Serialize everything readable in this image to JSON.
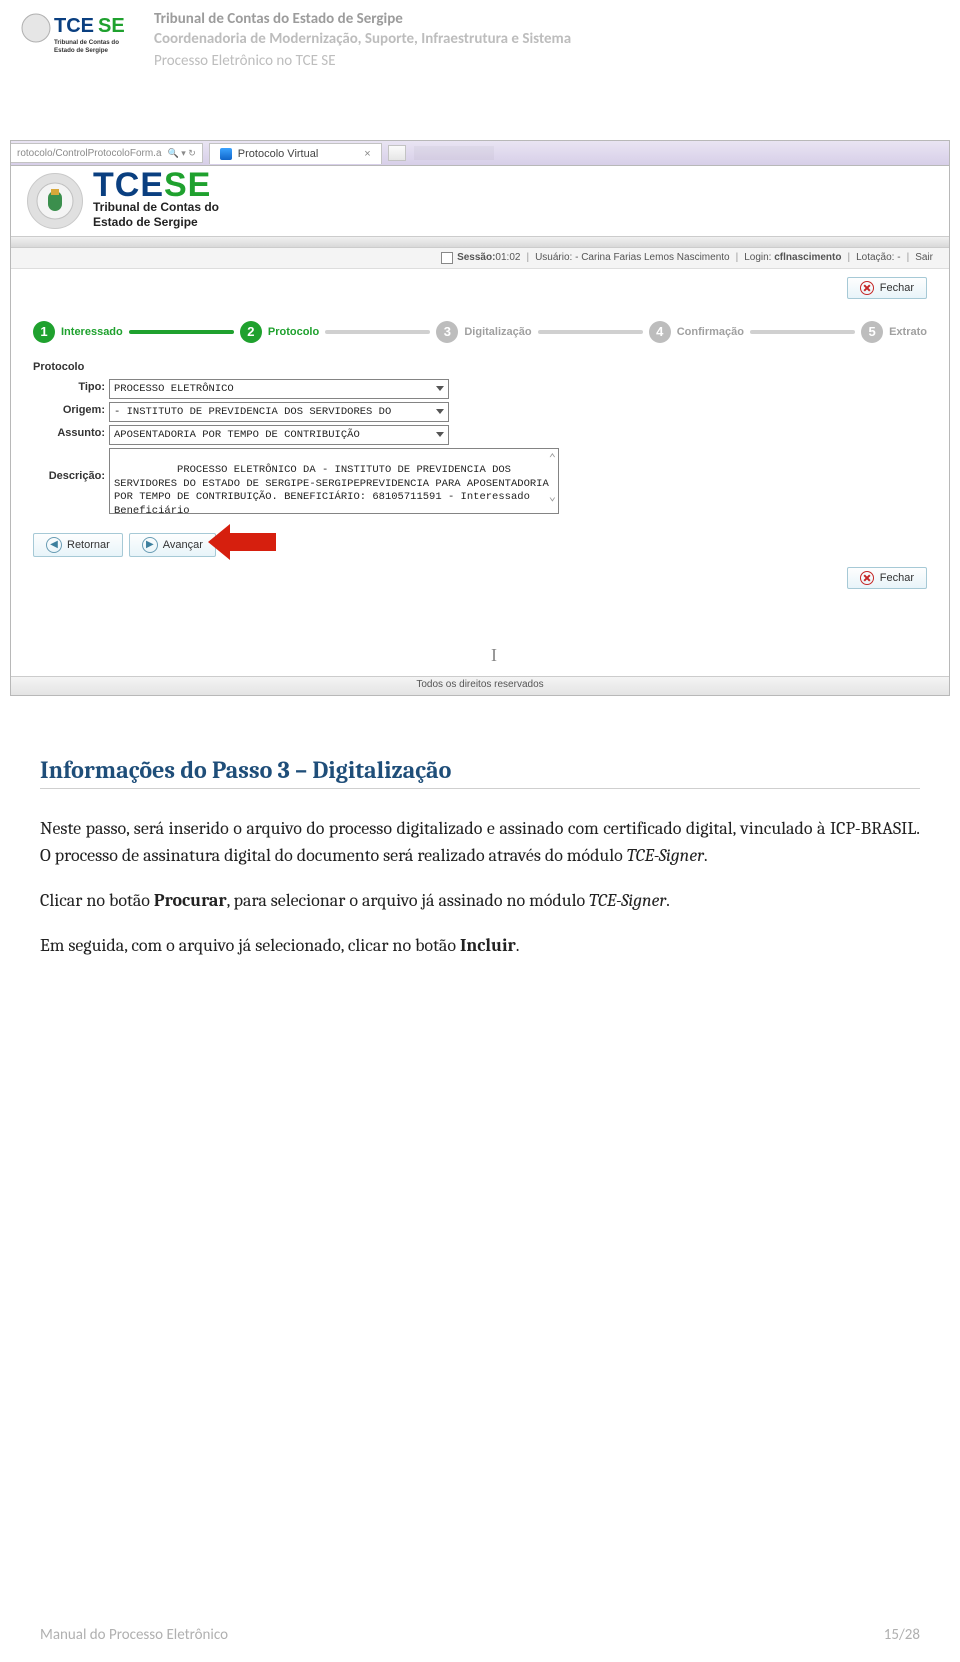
{
  "doc_header": {
    "org": "Tribunal de Contas do Estado de Sergipe",
    "dept": "Coordenadoria de Modernização, Suporte, Infraestrutura e Sistema",
    "doc": "Processo Eletrônico no TCE SE"
  },
  "ie": {
    "url_fragment": "rotocolo/ControlProtocoloForm.a",
    "search_refresh": "🔍 ▾ 🔄",
    "tab_title": "Protocolo Virtual",
    "tab_close": "×"
  },
  "site": {
    "tc": "TCE",
    "se": "SE",
    "sub1": "Tribunal de Contas do",
    "sub2": "Estado de Sergipe"
  },
  "session": {
    "sess_label": "Sessão:",
    "sess_val": "01:02",
    "user_label": "Usuário:",
    "user_val": "- Carina Farias Lemos Nascimento",
    "login_label": "Login:",
    "login_val": "cflnascimento",
    "lot_label": "Lotação:",
    "lot_val": "-",
    "exit": "Sair"
  },
  "buttons": {
    "fechar": "Fechar",
    "retornar": "Retornar",
    "avancar": "Avançar"
  },
  "stepper": [
    {
      "num": "1",
      "label": "Interessado",
      "on": true
    },
    {
      "num": "2",
      "label": "Protocolo",
      "on": true
    },
    {
      "num": "3",
      "label": "Digitalização",
      "on": false
    },
    {
      "num": "4",
      "label": "Confirmação",
      "on": false
    },
    {
      "num": "5",
      "label": "Extrato",
      "on": false
    }
  ],
  "form": {
    "section": "Protocolo",
    "tipo_label": "Tipo:",
    "tipo_val": "PROCESSO ELETRÔNICO",
    "origem_label": "Origem:",
    "origem_val": "- INSTITUTO DE PREVIDENCIA DOS SERVIDORES DO",
    "assunto_label": "Assunto:",
    "assunto_val": "APOSENTADORIA POR TEMPO DE CONTRIBUIÇÃO",
    "desc_label": "Descrição:",
    "desc_val": "PROCESSO ELETRÔNICO DA - INSTITUTO DE PREVIDENCIA DOS SERVIDORES DO ESTADO DE SERGIPE-SERGIPEPREVIDENCIA PARA APOSENTADORIA POR TEMPO DE CONTRIBUIÇÃO. BENEFICIÁRIO: 68105711591 - Interessado Beneficiário"
  },
  "site_footer": "Todos os direitos reservados",
  "article": {
    "heading": "Informações do Passo 3 – Digitalização",
    "p1_a": "Neste passo, será inserido o arquivo do processo digitalizado e assinado com certificado digital, vinculado à ICP-BRASIL. O processo de assinatura digital do documento será realizado através do módulo ",
    "p1_i": "TCE-Signer",
    "p1_b": ".",
    "p2_a": "Clicar no botão ",
    "p2_bold": "Procurar",
    "p2_b": ", para selecionar o arquivo já assinado no módulo ",
    "p2_i": "TCE-Signer",
    "p2_c": ".",
    "p3_a": "Em seguida, com o arquivo já selecionado, clicar no botão ",
    "p3_bold": "Incluir",
    "p3_b": "."
  },
  "page_footer": {
    "left": "Manual do Processo Eletrônico",
    "right": "15/28"
  }
}
